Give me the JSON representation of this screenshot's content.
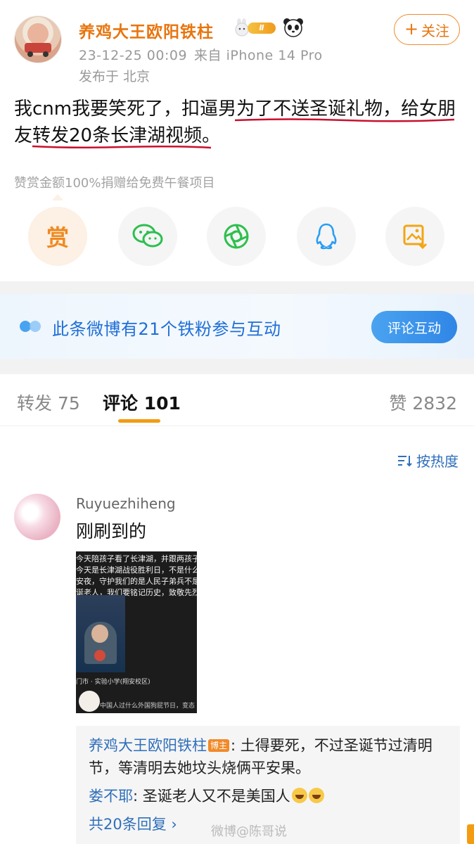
{
  "post": {
    "author": "养鸡大王欧阳铁柱",
    "level_badge": "Ⅱ",
    "follow_label": "关注",
    "timestamp": "23-12-25 00:09",
    "source": "来自 iPhone 14 Pro",
    "location": "发布于 北京",
    "text": "我cnm我要笑死了，扣逼男为了不送圣诞礼物，给女朋友转发20条长津湖视频。",
    "reward_note": "赞赏金额100%捐赠给免费午餐项目",
    "reward_button": "赏"
  },
  "banner": {
    "text": "此条微博有21个铁粉参与互动",
    "button": "评论互动"
  },
  "tabs": {
    "repost": "转发 75",
    "comments": "评论 101",
    "likes": "赞 2832"
  },
  "sort_label": "按热度",
  "comment": {
    "user": "Ruyuezhiheng",
    "text": "刚刷到的",
    "video": {
      "line1": "今天陪孩子看了长津湖，并跟两孩子说",
      "line2": "今天是长津湖战役胜利日，不是什么平",
      "line3": "安夜，守护我们的是人民子弟兵不是圣",
      "line4": "诞老人，我们要铭记历史，致敬先烈！",
      "school": "门市 · 实验小学(翔安校区)",
      "caption": "中国人过什么外国狗屁节日，变态"
    },
    "replies": [
      {
        "name": "养鸡大王欧阳铁柱",
        "badge": "博主",
        "text": ": 土得要死，不过圣诞节过清明节，等清明去她坟头烧俩平安果。"
      },
      {
        "name": "娄不耶",
        "text": ": 圣诞老人又不是美国人"
      }
    ],
    "more_replies": "共20条回复 ›"
  },
  "watermark": "微博@陈哥说",
  "colors": {
    "accent_orange": "#e8750e",
    "link_blue": "#2f6fba",
    "banner_blue": "#1f6ed6"
  }
}
